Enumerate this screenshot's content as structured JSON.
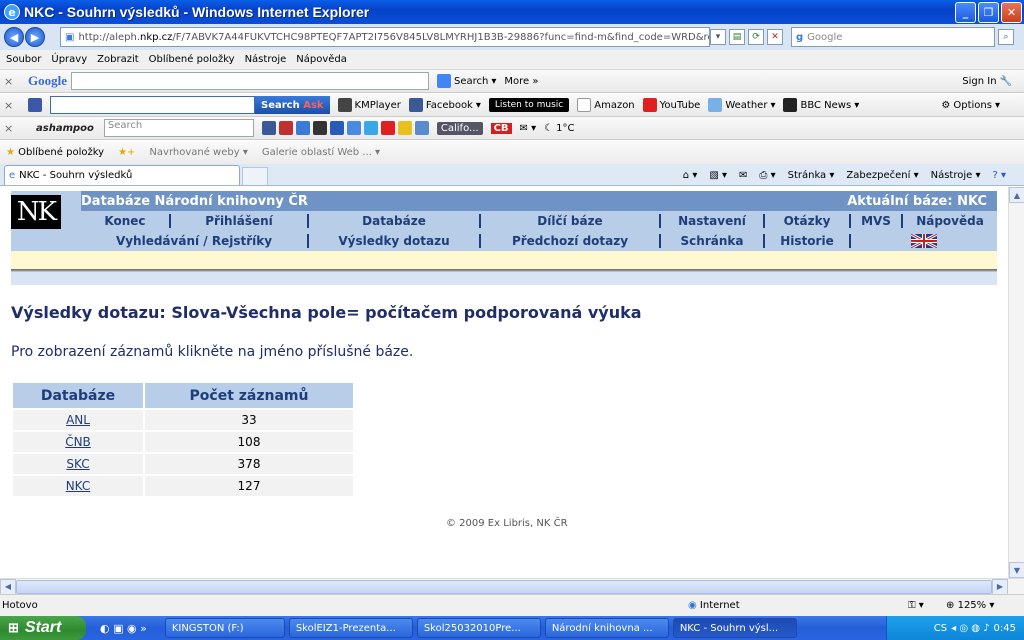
{
  "window": {
    "title": "NKC - Souhrn výsledků - Windows Internet Explorer"
  },
  "address": {
    "prefix": "http://aleph.",
    "host": "nkp.cz",
    "path": "/F/7ABVK7A44FUKVTCHC98PTEQF7APT2I756V845LV8LMYRHJ1B3B-29886?func=find-m&find_code=WRD&request=",
    "search_placeholder": "Google"
  },
  "menubar": [
    "Soubor",
    "Úpravy",
    "Zobrazit",
    "Oblíbené položky",
    "Nástroje",
    "Nápověda"
  ],
  "google_toolbar": {
    "logo": "Google",
    "search": "Search",
    "more": "More »",
    "signin": "Sign In"
  },
  "ask_toolbar": {
    "search": "Search",
    "kmplayer": "KMPlayer",
    "facebook": "Facebook",
    "listen": "Listen to music",
    "amazon": "Amazon",
    "youtube": "YouTube",
    "weather": "Weather",
    "bbc": "BBC News",
    "options": "Options"
  },
  "ashampoo_toolbar": {
    "logo": "ashampoo",
    "search": "Search",
    "weather_place": "Califo...",
    "temp": "1°C"
  },
  "favorites": {
    "fav": "Oblíbené položky",
    "suggested": "Navrhované weby",
    "gallery": "Galerie oblastí Web ..."
  },
  "tab": {
    "label": "NKC - Souhrn výsledků"
  },
  "commands": {
    "page": "Stránka",
    "security": "Zabezpečení",
    "tools": "Nástroje"
  },
  "nk": {
    "logo": "NK",
    "title": "Databáze Národní knihovny ČR",
    "current_base": "Aktuální báze:  NKC",
    "nav1": [
      "Konec",
      "Přihlášení",
      "Databáze",
      "Dílčí báze",
      "Nastavení",
      "Otázky",
      "MVS",
      "Nápověda"
    ],
    "nav2": [
      "Vyhledávání / Rejstříky",
      "Výsledky dotazu",
      "Předchozí dotazy",
      "Schránka",
      "Historie"
    ]
  },
  "results": {
    "title": "Výsledky dotazu:  Slova-Všechna pole= počítačem podporovaná výuka",
    "hint": "Pro zobrazení záznamů klikněte na jméno příslušné báze.",
    "headers": [
      "Databáze",
      "Počet záznamů"
    ],
    "rows": [
      {
        "db": "ANL",
        "count": "33"
      },
      {
        "db": "ČNB",
        "count": "108"
      },
      {
        "db": "SKC",
        "count": "378"
      },
      {
        "db": "NKC",
        "count": "127"
      }
    ],
    "footer": "© 2009 Ex Libris, NK ČR"
  },
  "status": {
    "left": "Hotovo",
    "zone": "Internet",
    "zoom": "125%"
  },
  "taskbar": {
    "start": "Start",
    "items": [
      "KINGSTON (F:)",
      "SkolEIZ1-Prezenta...",
      "Skol25032010Pre...",
      "Národní knihovna ...",
      "NKC - Souhrn výsl..."
    ],
    "tray_lang": "CS",
    "clock": "0:45"
  },
  "colors": {
    "accent": "#1f3d7a",
    "header_bg": "#b7cde8",
    "title_bg": "#6f93c4"
  }
}
